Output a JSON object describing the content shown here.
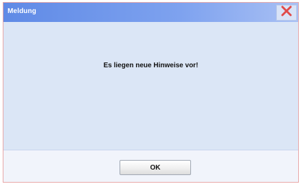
{
  "dialog": {
    "title": "Meldung",
    "message": "Es liegen neue Hinweise vor!",
    "ok_label": "OK",
    "close_icon": "close-x-icon"
  },
  "colors": {
    "titlebar": "#5f8ae6",
    "body": "#dbe6f6",
    "footer": "#f1f4fb",
    "close_x": "#e04a4a"
  }
}
